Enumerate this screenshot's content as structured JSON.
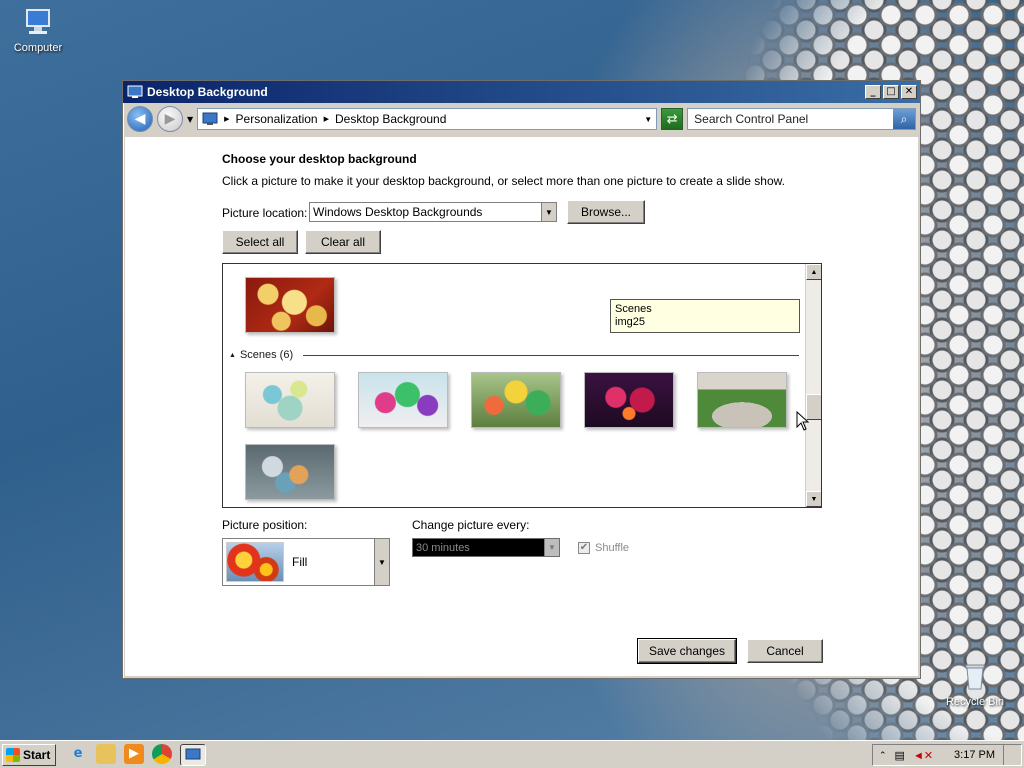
{
  "desktop": {
    "icons": [
      {
        "label": "Computer",
        "icon": "computer-icon"
      },
      {
        "label": "Recycle Bin",
        "icon": "recycle-bin-icon"
      }
    ]
  },
  "window": {
    "title": "Desktop Background",
    "controls": {
      "minimize": "_",
      "maximize": "□",
      "close": "✕"
    },
    "address": {
      "crumbs": [
        "Personalization",
        "Desktop Background"
      ]
    },
    "search_placeholder": "Search Control Panel",
    "heading": "Choose your desktop background",
    "subheading": "Click a picture to make it your desktop background, or select more than one picture to create a slide show.",
    "picture_location": {
      "label": "Picture location:",
      "value": "Windows Desktop Backgrounds"
    },
    "browse_label": "Browse...",
    "select_all_label": "Select all",
    "clear_all_label": "Clear all",
    "gallery": {
      "group_name": "Scenes (6)",
      "tooltip": {
        "line1": "Scenes",
        "line2": "img25"
      }
    },
    "picture_position": {
      "label": "Picture position:",
      "value": "Fill"
    },
    "change_picture": {
      "label": "Change picture every:",
      "value": "30 minutes"
    },
    "shuffle_label": "Shuffle",
    "save_label": "Save changes",
    "cancel_label": "Cancel"
  },
  "taskbar": {
    "start_label": "Start",
    "clock": "3:17 PM"
  },
  "colors": {
    "title_bar": "#0a246a",
    "tooltip_bg": "#ffffe1",
    "window_face": "#d4d0c8"
  }
}
